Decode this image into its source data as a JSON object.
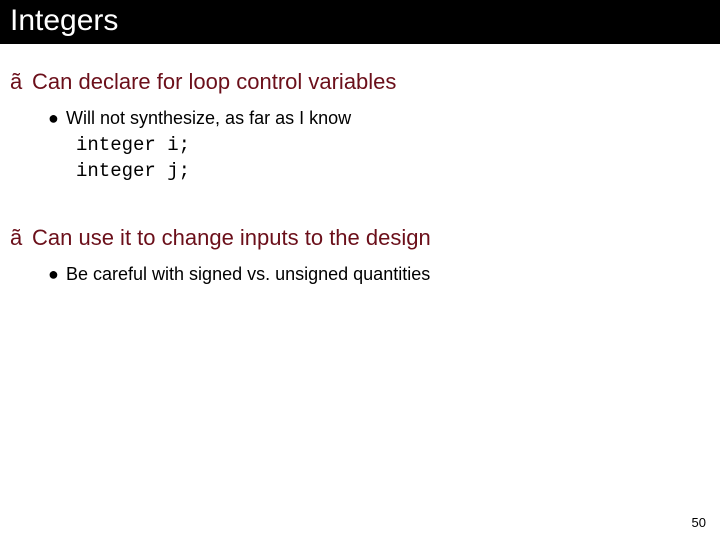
{
  "title": "Integers",
  "bullets": [
    {
      "level": 1,
      "marker": "ã",
      "text": "Can declare for loop control variables",
      "sub": [
        {
          "level": 2,
          "marker": "●",
          "text": "Will not synthesize, as far as I know",
          "code": "integer i;\ninteger j;"
        }
      ]
    },
    {
      "level": 1,
      "marker": "ã",
      "text": "Can use it to change inputs to the design",
      "sub": [
        {
          "level": 2,
          "marker": "●",
          "text": "Be careful with signed vs. unsigned quantities"
        }
      ]
    }
  ],
  "page_number": "50"
}
